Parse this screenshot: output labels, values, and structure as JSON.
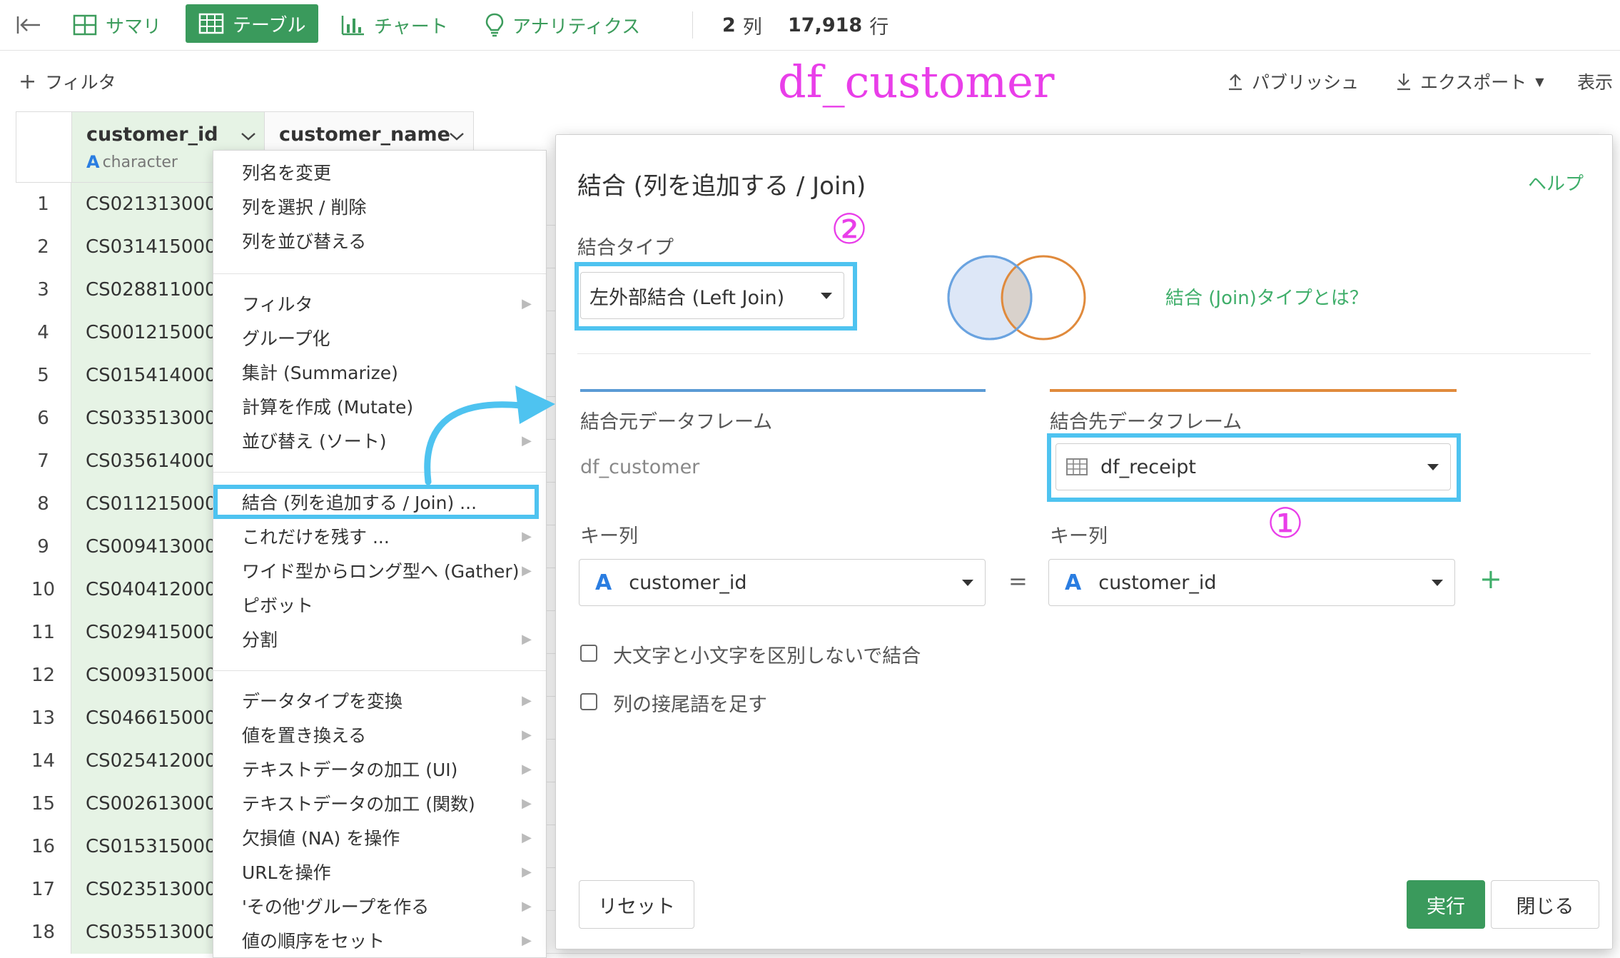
{
  "topbar": {
    "summary": "サマリ",
    "table": "テーブル",
    "chart": "チャート",
    "analytics": "アナリティクス",
    "cols_num": "2",
    "cols_unit": "列",
    "rows_num": "17,918",
    "rows_unit": "行"
  },
  "subbar": {
    "filter": "フィルタ",
    "publish": "パブリッシュ",
    "export": "エクスポート",
    "display": "表示"
  },
  "annotation_title": "df_customer",
  "table": {
    "columns": [
      {
        "name": "customer_id",
        "type": "character"
      },
      {
        "name": "customer_name"
      }
    ],
    "rows": [
      {
        "n": "1",
        "id": "CS021313000"
      },
      {
        "n": "2",
        "id": "CS031415000"
      },
      {
        "n": "3",
        "id": "CS028811000"
      },
      {
        "n": "4",
        "id": "CS001215000"
      },
      {
        "n": "5",
        "id": "CS015414000"
      },
      {
        "n": "6",
        "id": "CS033513000"
      },
      {
        "n": "7",
        "id": "CS035614000"
      },
      {
        "n": "8",
        "id": "CS011215000"
      },
      {
        "n": "9",
        "id": "CS009413000"
      },
      {
        "n": "10",
        "id": "CS040412000"
      },
      {
        "n": "11",
        "id": "CS029415000"
      },
      {
        "n": "12",
        "id": "CS009315000"
      },
      {
        "n": "13",
        "id": "CS046615000"
      },
      {
        "n": "14",
        "id": "CS025412000"
      },
      {
        "n": "15",
        "id": "CS002613000"
      },
      {
        "n": "16",
        "id": "CS015315000"
      },
      {
        "n": "17",
        "id": "CS023513000"
      },
      {
        "n": "18",
        "id": "CS035513000"
      }
    ]
  },
  "menu": {
    "group1": [
      "列名を変更",
      "列を選択 / 削除",
      "列を並び替える"
    ],
    "group2": [
      {
        "label": "フィルタ",
        "arrow": true
      },
      {
        "label": "グループ化",
        "arrow": false
      },
      {
        "label": "集計 (Summarize)",
        "arrow": false
      },
      {
        "label": "計算を作成 (Mutate)",
        "arrow": false
      },
      {
        "label": "並び替え (ソート)",
        "arrow": true
      }
    ],
    "group3": [
      {
        "label": "結合 (列を追加する / Join) ...",
        "arrow": false
      },
      {
        "label": "これだけを残す ...",
        "arrow": true
      },
      {
        "label": "ワイド型からロング型へ (Gather)",
        "arrow": true
      },
      {
        "label": "ピボット",
        "arrow": false
      },
      {
        "label": "分割",
        "arrow": true
      }
    ],
    "group4": [
      {
        "label": "データタイプを変換",
        "arrow": true
      },
      {
        "label": "値を置き換える",
        "arrow": true
      },
      {
        "label": "テキストデータの加工 (UI)",
        "arrow": true
      },
      {
        "label": "テキストデータの加工 (関数)",
        "arrow": true
      },
      {
        "label": "欠損値 (NA) を操作",
        "arrow": true
      },
      {
        "label": "URLを操作",
        "arrow": true
      },
      {
        "label": "'その他'グループを作る",
        "arrow": true
      },
      {
        "label": "値の順序をセット",
        "arrow": true
      }
    ]
  },
  "dialog": {
    "title": "結合 (列を追加する / Join)",
    "help": "ヘルプ",
    "join_type_label": "結合タイプ",
    "join_type_value": "左外部結合 (Left Join)",
    "join_type_link": "結合 (Join)タイプとは？",
    "source_label": "結合元データフレーム",
    "source_value": "df_customer",
    "target_label": "結合先データフレーム",
    "target_value": "df_receipt",
    "key_label_left": "キー列",
    "key_label_right": "キー列",
    "key_left": "customer_id",
    "key_right": "customer_id",
    "key_type_glyph": "A",
    "equals": "=",
    "add": "+",
    "option_case": "大文字と小文字を区別しないで結合",
    "option_suffix": "列の接尾語を足す",
    "reset": "リセット",
    "run": "実行",
    "close": "閉じる",
    "marker_1": "①",
    "marker_2": "②"
  },
  "colors": {
    "brand_green": "#3a9a5c",
    "highlight_blue": "#4ec3f0",
    "annotation_magenta": "#e93ee9",
    "source_line": "#5b9bd5",
    "target_line": "#e08a3c"
  }
}
